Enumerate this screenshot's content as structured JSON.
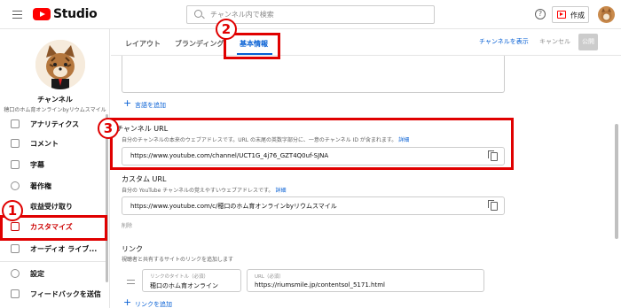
{
  "app": {
    "studio_label": "Studio",
    "search_placeholder": "チャンネル内で検索",
    "help_glyph": "?",
    "create_label": "作成"
  },
  "sidebar": {
    "channel_title": "チャンネル",
    "channel_name": "穂口のホム育オンラインbyリウムスマイル",
    "items": [
      {
        "label": "アナリティクス",
        "icon": "analytics-icon"
      },
      {
        "label": "コメント",
        "icon": "comment-icon"
      },
      {
        "label": "字幕",
        "icon": "subtitles-icon"
      },
      {
        "label": "著作権",
        "icon": "copyright-icon"
      },
      {
        "label": "収益受け取り",
        "icon": "monetization-icon"
      },
      {
        "label": "カスタマイズ",
        "icon": "customize-icon"
      },
      {
        "label": "オーディオ ライブ...",
        "icon": "audio-library-icon"
      },
      {
        "label": "設定",
        "icon": "gear-icon"
      },
      {
        "label": "フィードバックを送信",
        "icon": "feedback-icon"
      }
    ]
  },
  "header": {
    "tabs": [
      "レイアウト",
      "ブランディング",
      "基本情報"
    ],
    "view_channel": "チャンネルを表示",
    "cancel": "キャンセル",
    "publish": "公開"
  },
  "main": {
    "add_language": "言語を追加",
    "channel_url": {
      "title": "チャンネル URL",
      "desc": "自分のチャンネルの本来のウェブアドレスです。URL の末尾の英数字部分に、一意のチャンネル ID が含まれます。",
      "detail": "詳細",
      "value": "https://www.youtube.com/channel/UCT1G_4j76_GZT4Q0uf-SJNA"
    },
    "custom_url": {
      "title": "カスタム URL",
      "desc": "自分の YouTube チャンネルの覚えやすいウェブアドレスです。",
      "detail": "詳細",
      "value": "https://www.youtube.com/c/穂口のホム育オンラインbyリウムスマイル",
      "delete": "削除"
    },
    "links": {
      "title": "リンク",
      "desc": "視聴者と共有するサイトのリンクを追加します",
      "title_field_label": "リンクのタイトル（必須）",
      "title_field_value": "穂口のホム育オンライン",
      "url_field_label": "URL（必須）",
      "url_field_value": "https://riumsmile.jp/contentsol_5171.html",
      "add_link": "リンクを追加"
    }
  },
  "annotations": {
    "badge1": "1",
    "badge2": "2",
    "badge3": "3"
  },
  "colors": {
    "accent": "#065fd4",
    "brand_red": "#ff0000",
    "annotation_red": "#e00000"
  }
}
